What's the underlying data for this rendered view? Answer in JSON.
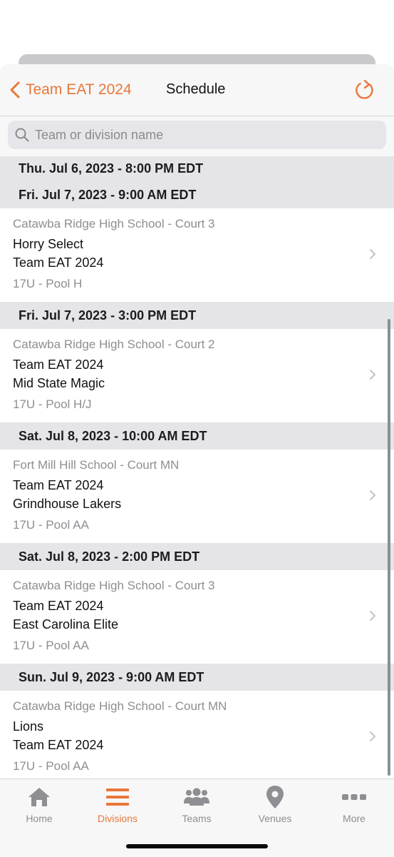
{
  "nav": {
    "back_label": "Team EAT 2024",
    "title": "Schedule"
  },
  "search": {
    "placeholder": "Team or division name"
  },
  "schedule": {
    "top_header": "Thu. Jul 6, 2023 - 8:00 PM EDT",
    "groups": [
      {
        "header": "Fri. Jul 7, 2023 - 9:00 AM EDT",
        "venue": "Catawba Ridge High School - Court 3",
        "team1": "Horry Select",
        "team2": "Team EAT 2024",
        "division": "17U - Pool H"
      },
      {
        "header": "Fri. Jul 7, 2023 - 3:00 PM EDT",
        "venue": "Catawba Ridge High School - Court 2",
        "team1": "Team EAT 2024",
        "team2": "Mid State Magic",
        "division": "17U - Pool H/J"
      },
      {
        "header": "Sat. Jul 8, 2023 - 10:00 AM EDT",
        "venue": "Fort Mill Hill School - Court MN",
        "team1": "Team EAT 2024",
        "team2": "Grindhouse Lakers",
        "division": "17U - Pool AA"
      },
      {
        "header": "Sat. Jul 8, 2023 - 2:00 PM EDT",
        "venue": "Catawba Ridge High School - Court 3",
        "team1": "Team EAT 2024",
        "team2": "East Carolina Elite",
        "division": "17U - Pool AA"
      },
      {
        "header": "Sun. Jul 9, 2023 - 9:00 AM EDT",
        "venue": "Catawba Ridge High School - Court MN",
        "team1": "Lions",
        "team2": "Team EAT 2024",
        "division": "17U - Pool AA"
      }
    ]
  },
  "tabbar": {
    "tabs": [
      {
        "label": "Home",
        "icon": "home-icon"
      },
      {
        "label": "Divisions",
        "icon": "divisions-icon",
        "active": true
      },
      {
        "label": "Teams",
        "icon": "teams-icon"
      },
      {
        "label": "Venues",
        "icon": "venues-icon"
      },
      {
        "label": "More",
        "icon": "more-icon"
      }
    ]
  },
  "colors": {
    "accent": "#e8773a",
    "inactive": "#8e8e93",
    "section_bg": "#e5e5e7"
  }
}
